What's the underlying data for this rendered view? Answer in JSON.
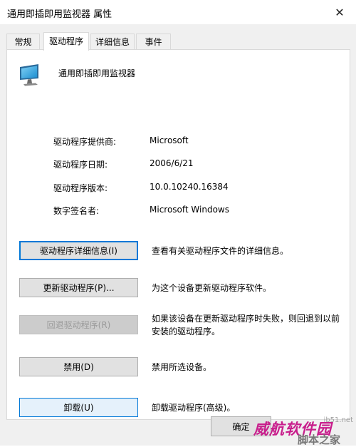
{
  "window": {
    "title": "通用即插即用监视器 属性",
    "close_symbol": "✕"
  },
  "tabs": [
    {
      "label": "常规"
    },
    {
      "label": "驱动程序",
      "active": true
    },
    {
      "label": "详细信息"
    },
    {
      "label": "事件"
    }
  ],
  "device": {
    "icon": "monitor-icon",
    "name": "通用即插即用监视器"
  },
  "properties": [
    {
      "label": "驱动程序提供商:",
      "value": "Microsoft"
    },
    {
      "label": "驱动程序日期:",
      "value": "2006/6/21"
    },
    {
      "label": "驱动程序版本:",
      "value": "10.0.10240.16384"
    },
    {
      "label": "数字签名者:",
      "value": "Microsoft Windows"
    }
  ],
  "actions": [
    {
      "button": "驱动程序详细信息(I)",
      "description": "查看有关驱动程序文件的详细信息。",
      "state": "focused"
    },
    {
      "button": "更新驱动程序(P)...",
      "description": "为这个设备更新驱动程序软件。",
      "state": "normal"
    },
    {
      "button": "回退驱动程序(R)",
      "description": "如果该设备在更新驱动程序时失败，则回退到以前安装的驱动程序。",
      "state": "disabled"
    },
    {
      "button": "禁用(D)",
      "description": "禁用所选设备。",
      "state": "normal"
    },
    {
      "button": "卸载(U)",
      "description": "卸载驱动程序(高级)。",
      "state": "hot"
    }
  ],
  "footer": {
    "ok_label": "确定"
  },
  "watermark": {
    "main": "威航软件园",
    "sub": "jb51.net",
    "bottom": "脚本之家"
  },
  "colors": {
    "accent": "#0078d7",
    "dialog_bg": "#f0f0f0",
    "watermark": "#c81e8c"
  }
}
